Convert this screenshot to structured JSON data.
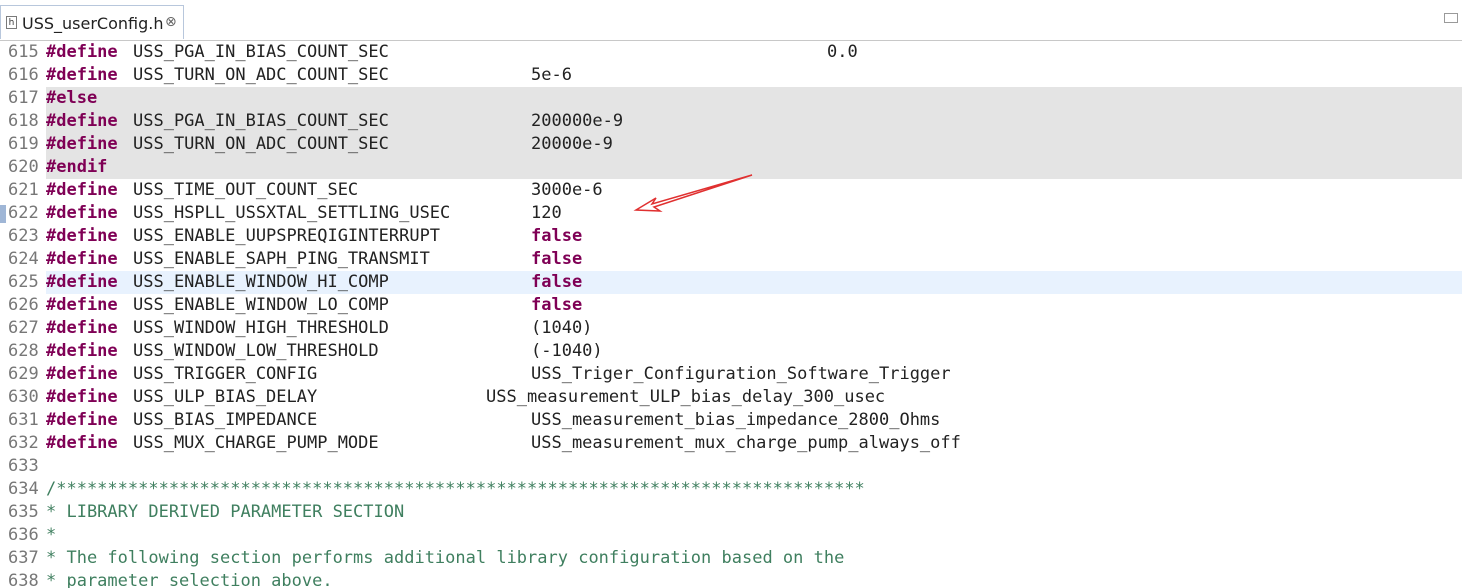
{
  "tab": {
    "title": "USS_userConfig.h",
    "close_symbol": "⊗",
    "icon_letter": "h"
  },
  "colors": {
    "keyword": "#7f0055",
    "comment": "#3f7f5f",
    "inactive_bg": "#e4e4e4",
    "current_line_bg": "#e8f2fe",
    "annotation_arrow": "#e03030"
  },
  "lines": [
    {
      "num": "615",
      "kw": "#define",
      "name": "USS_PGA_IN_BIAS_COUNT_SEC",
      "value": "0.0",
      "value_kw": false
    },
    {
      "num": "616",
      "kw": "#define",
      "name": "USS_TURN_ON_ADC_COUNT_SEC",
      "value": "5e-6",
      "value_kw": false
    },
    {
      "num": "617",
      "kw": "#else",
      "name": "",
      "value": "",
      "value_kw": false
    },
    {
      "num": "618",
      "kw": "#define",
      "name": "USS_PGA_IN_BIAS_COUNT_SEC",
      "value": "200000e-9",
      "value_kw": false
    },
    {
      "num": "619",
      "kw": "#define",
      "name": "USS_TURN_ON_ADC_COUNT_SEC",
      "value": "20000e-9",
      "value_kw": false
    },
    {
      "num": "620",
      "kw": "#endif",
      "name": "",
      "value": "",
      "value_kw": false
    },
    {
      "num": "621",
      "kw": "#define",
      "name": "USS_TIME_OUT_COUNT_SEC",
      "value": "3000e-6",
      "value_kw": false
    },
    {
      "num": "622",
      "kw": "#define",
      "name": "USS_HSPLL_USSXTAL_SETTLING_USEC",
      "value": "120",
      "value_kw": false
    },
    {
      "num": "623",
      "kw": "#define",
      "name": "USS_ENABLE_UUPSPREQIGINTERRUPT",
      "value": "false",
      "value_kw": true
    },
    {
      "num": "624",
      "kw": "#define",
      "name": "USS_ENABLE_SAPH_PING_TRANSMIT",
      "value": "false",
      "value_kw": true
    },
    {
      "num": "625",
      "kw": "#define",
      "name": "USS_ENABLE_WINDOW_HI_COMP",
      "value": "false",
      "value_kw": true
    },
    {
      "num": "626",
      "kw": "#define",
      "name": "USS_ENABLE_WINDOW_LO_COMP",
      "value": "false",
      "value_kw": true
    },
    {
      "num": "627",
      "kw": "#define",
      "name": "USS_WINDOW_HIGH_THRESHOLD",
      "value": "(1040)",
      "value_kw": false
    },
    {
      "num": "628",
      "kw": "#define",
      "name": "USS_WINDOW_LOW_THRESHOLD",
      "value": "(-1040)",
      "value_kw": false
    },
    {
      "num": "629",
      "kw": "#define",
      "name": "USS_TRIGGER_CONFIG",
      "value": "USS_Triger_Configuration_Software_Trigger",
      "value_kw": false
    },
    {
      "num": "630",
      "kw": "#define",
      "name": "USS_ULP_BIAS_DELAY",
      "value": "USS_measurement_ULP_bias_delay_300_usec",
      "value_kw": false
    },
    {
      "num": "631",
      "kw": "#define",
      "name": "USS_BIAS_IMPEDANCE",
      "value": "USS_measurement_bias_impedance_2800_Ohms",
      "value_kw": false
    },
    {
      "num": "632",
      "kw": "#define",
      "name": "USS_MUX_CHARGE_PUMP_MODE",
      "value": "USS_measurement_mux_charge_pump_always_off",
      "value_kw": false
    },
    {
      "num": "633",
      "kw": "",
      "name": "",
      "value": "",
      "value_kw": false
    },
    {
      "num": "634",
      "comment": "/*******************************************************************************"
    },
    {
      "num": "635",
      "comment": "* LIBRARY DERIVED PARAMETER SECTION"
    },
    {
      "num": "636",
      "comment": "*"
    },
    {
      "num": "637",
      "comment": "* The following section performs additional library configuration based on the"
    },
    {
      "num": "638",
      "comment": "* parameter selection above."
    }
  ]
}
